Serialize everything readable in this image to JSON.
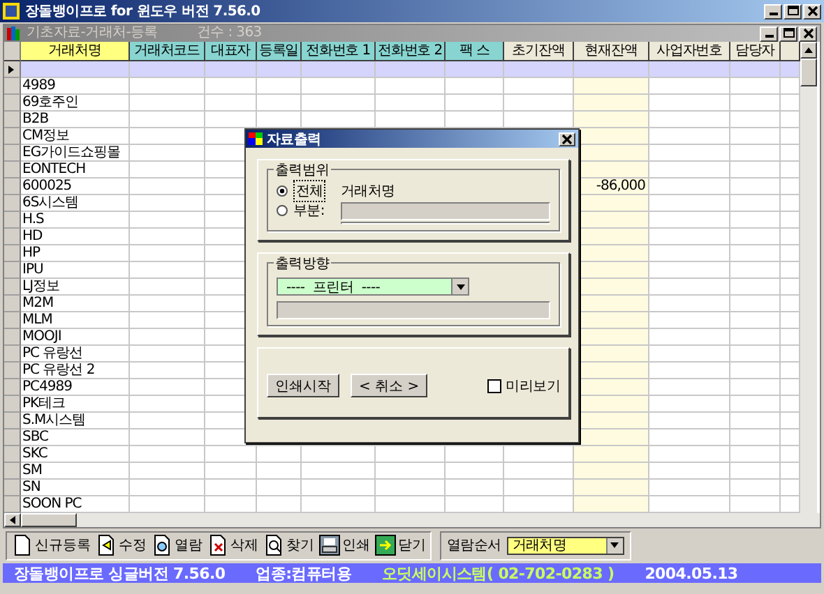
{
  "window": {
    "title": "장돌뱅이프로 for 윈도우 버전 7.56.0"
  },
  "child_window": {
    "title": "기초자료-거래처-등록",
    "count": "건수 : 363"
  },
  "table": {
    "columns": [
      {
        "label": "거래처명",
        "color": "#ffff80",
        "highlighted": false
      },
      {
        "label": "거래처코드",
        "color": "#88d4d0",
        "highlighted": false
      },
      {
        "label": "대표자",
        "color": "#88d4d0",
        "highlighted": false
      },
      {
        "label": "등록일",
        "color": "#88d4d0",
        "highlighted": false
      },
      {
        "label": "전화번호 1",
        "color": "#88d4d0",
        "highlighted": false
      },
      {
        "label": "전화번호 2",
        "color": "#88d4d0",
        "highlighted": false
      },
      {
        "label": "팩 스",
        "color": "#88d4d0",
        "highlighted": false
      },
      {
        "label": "초기잔액",
        "color": "#ece9d8",
        "highlighted": false
      },
      {
        "label": "현재잔액",
        "color": "#ece9d8",
        "highlighted": true
      },
      {
        "label": "사업자번호",
        "color": "#ece9d8",
        "highlighted": false
      },
      {
        "label": "담당자",
        "color": "#ece9d8",
        "highlighted": false
      }
    ],
    "rows": [
      {
        "selected": true
      },
      {
        "name": "4989",
        "selected": false
      },
      {
        "name": "69호주인",
        "selected": false
      },
      {
        "name": "B2B",
        "selected": false
      },
      {
        "name": "CM정보",
        "selected": false
      },
      {
        "name": "EG가이드쇼핑몰",
        "selected": false
      },
      {
        "name": "EONTECH",
        "selected": false
      },
      {
        "name": "600025",
        "balance": "-86,000",
        "selected": false
      },
      {
        "name": "6S시스템",
        "selected": false
      },
      {
        "name": "H.S",
        "selected": false
      },
      {
        "name": "HD",
        "selected": false
      },
      {
        "name": "HP",
        "selected": false
      },
      {
        "name": "IPU",
        "selected": false
      },
      {
        "name": "LJ정보",
        "selected": false
      },
      {
        "name": "M2M",
        "selected": false
      },
      {
        "name": "MLM",
        "selected": false
      },
      {
        "name": "MOOJI",
        "selected": false
      },
      {
        "name": "PC 유랑선",
        "selected": false
      },
      {
        "name": "PC 유랑선 2",
        "selected": false
      },
      {
        "name": "PC4989",
        "selected": false
      },
      {
        "name": "PK테크",
        "selected": false
      },
      {
        "name": "S.M시스템",
        "selected": false
      },
      {
        "name": "SBC",
        "selected": false
      },
      {
        "name": "SKC",
        "selected": false
      },
      {
        "name": "SM",
        "selected": false
      },
      {
        "name": "SN",
        "selected": false
      },
      {
        "name": "SOON PC",
        "selected": false
      }
    ]
  },
  "dialog": {
    "title": "자료출력",
    "range_group": {
      "label": "출력범위",
      "options": [
        {
          "label": "전체",
          "selected": true
        },
        {
          "label": "부분:",
          "selected": false
        }
      ],
      "field_label": "거래처명"
    },
    "output_group": {
      "label": "출력방향",
      "dropdown": "----  프린터  ----"
    },
    "buttons": [
      "인쇄시작",
      "< 취소 >"
    ],
    "preview": {
      "label": "미리보기",
      "checked": false
    }
  },
  "toolbar": {
    "buttons": [
      {
        "label": "신규등록",
        "kind": "new"
      },
      {
        "label": "수정",
        "kind": "edit"
      },
      {
        "label": "열람",
        "kind": "view"
      },
      {
        "label": "삭제",
        "kind": "delete"
      },
      {
        "label": "찾기",
        "kind": "find"
      },
      {
        "label": "인쇄",
        "kind": "print"
      },
      {
        "label": "닫기",
        "kind": "close"
      }
    ],
    "sort_label": "열람순서",
    "sort_value": "거래처명"
  },
  "status_bar": [
    {
      "text": "장돌뱅이프로 싱글버전 7.56.0",
      "kind": "info"
    },
    {
      "text": "업종:컴퓨터용",
      "kind": "info"
    },
    {
      "text": "오딧세이시스템( 02-702-0283 )",
      "kind": "vendor"
    },
    {
      "text": "2004.05.13",
      "kind": "info"
    }
  ]
}
